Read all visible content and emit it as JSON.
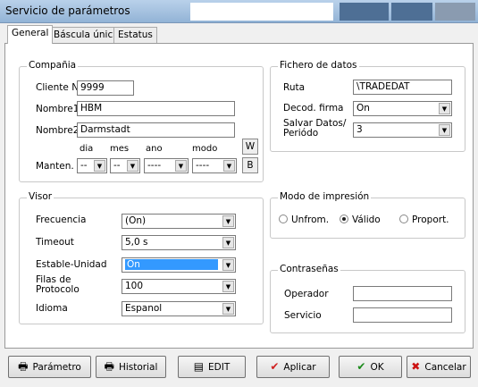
{
  "window": {
    "title": "Servicio de parámetros"
  },
  "tabs": [
    {
      "label": "General",
      "active": true
    },
    {
      "label": "Báscula única",
      "active": false
    },
    {
      "label": "Estatus",
      "active": false
    }
  ],
  "compania": {
    "group_label": "Compañia",
    "cliente_label": "Cliente Nº",
    "cliente_value": "9999",
    "nombre1_label": "Nombre1",
    "nombre1_value": "HBM",
    "nombre2_label": "Nombre2",
    "nombre2_value": "Darmstadt",
    "manten_label": "Manten.",
    "col_dia": "dia",
    "col_mes": "mes",
    "col_ano": "ano",
    "col_modo": "modo",
    "dia_value": "--",
    "mes_value": "--",
    "ano_value": "----",
    "modo_value": "----",
    "w_label": "W",
    "b_label": "B"
  },
  "fichero": {
    "group_label": "Fichero de datos",
    "ruta_label": "Ruta",
    "ruta_value": "\\TRADEDAT",
    "decod_label": "Decod. firma",
    "decod_value": "On",
    "salvar_label1": "Salvar Datos/",
    "salvar_label2": "Periódo",
    "salvar_value": "3"
  },
  "visor": {
    "group_label": "Visor",
    "frecuencia_label": "Frecuencia",
    "frecuencia_value": "(On)",
    "timeout_label": "Timeout",
    "timeout_value": "5,0 s",
    "estable_label": "Estable-Unidad",
    "estable_value": "On",
    "filas_label1": "Filas de",
    "filas_label2": "Protocolo",
    "filas_value": "100",
    "idioma_label": "Idioma",
    "idioma_value": "Espanol"
  },
  "modo_impresion": {
    "group_label": "Modo de impresión",
    "options": [
      "Unfrom.",
      "Válido",
      "Proport."
    ],
    "selected": "Válido"
  },
  "contrasenas": {
    "group_label": "Contraseñas",
    "operador_label": "Operador",
    "operador_value": "",
    "servicio_label": "Servicio",
    "servicio_value": ""
  },
  "buttons": {
    "parametro": "Parámetro",
    "historial": "Historial",
    "edit": "EDIT",
    "aplicar": "Aplicar",
    "ok": "OK",
    "cancelar": "Cancelar"
  },
  "colors": {
    "selection": "#3399ff",
    "check_red": "#d02020",
    "check_green": "#1a8a1a",
    "cancel_red": "#cc1111"
  }
}
